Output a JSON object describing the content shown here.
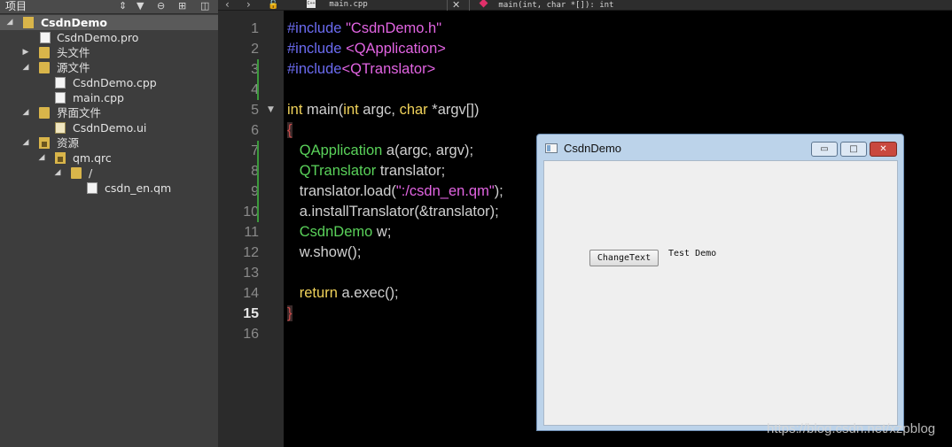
{
  "project_panel": {
    "title": "项目",
    "tree": [
      {
        "label": "CsdnDemo",
        "icon": "project-icon",
        "expanded": true,
        "selected": true
      },
      {
        "label": "CsdnDemo.pro",
        "icon": "pro-file-icon"
      },
      {
        "label": "头文件",
        "icon": "header-folder-icon",
        "expanded": false
      },
      {
        "label": "源文件",
        "icon": "source-folder-icon",
        "expanded": true
      },
      {
        "label": "CsdnDemo.cpp",
        "icon": "cpp-file-icon"
      },
      {
        "label": "main.cpp",
        "icon": "cpp-file-icon"
      },
      {
        "label": "界面文件",
        "icon": "forms-folder-icon",
        "expanded": true
      },
      {
        "label": "CsdnDemo.ui",
        "icon": "ui-file-icon"
      },
      {
        "label": "资源",
        "icon": "resources-folder-icon",
        "expanded": true
      },
      {
        "label": "qm.qrc",
        "icon": "qrc-file-icon",
        "expanded": true
      },
      {
        "label": "/",
        "icon": "folder-icon",
        "expanded": true
      },
      {
        "label": "csdn_en.qm",
        "icon": "file-icon"
      }
    ]
  },
  "editor": {
    "file_tab": "main.cpp",
    "file_tab_badge": "C++",
    "symbol": "main(int, char *[]): int",
    "current_line": 15,
    "lines": [
      [
        {
          "t": "#include ",
          "c": "pre"
        },
        {
          "t": "\"CsdnDemo.h\"",
          "c": "str"
        }
      ],
      [
        {
          "t": "#include ",
          "c": "pre"
        },
        {
          "t": "<QApplication>",
          "c": "str"
        }
      ],
      [
        {
          "t": "#include",
          "c": "pre"
        },
        {
          "t": "<QTranslator>",
          "c": "str"
        }
      ],
      [],
      [
        {
          "t": "int",
          "c": "kw"
        },
        {
          "t": " main(",
          "c": "plain"
        },
        {
          "t": "int",
          "c": "kw"
        },
        {
          "t": " argc, ",
          "c": "plain"
        },
        {
          "t": "char",
          "c": "kw"
        },
        {
          "t": " *argv[])",
          "c": "plain"
        }
      ],
      [
        {
          "t": "{",
          "c": "brace"
        }
      ],
      [
        {
          "t": "   ",
          "c": "plain"
        },
        {
          "t": "QApplication",
          "c": "type"
        },
        {
          "t": " a(argc, argv);",
          "c": "plain"
        }
      ],
      [
        {
          "t": "   ",
          "c": "plain"
        },
        {
          "t": "QTranslator",
          "c": "type"
        },
        {
          "t": " translator;",
          "c": "plain"
        }
      ],
      [
        {
          "t": "   translator.load(",
          "c": "plain"
        },
        {
          "t": "\":/csdn_en.qm\"",
          "c": "str"
        },
        {
          "t": ");",
          "c": "plain"
        }
      ],
      [
        {
          "t": "   a.installTranslator(&translator);",
          "c": "plain"
        }
      ],
      [
        {
          "t": "   ",
          "c": "plain"
        },
        {
          "t": "CsdnDemo",
          "c": "type"
        },
        {
          "t": " w;",
          "c": "plain"
        }
      ],
      [
        {
          "t": "   w.show();",
          "c": "plain"
        }
      ],
      [],
      [
        {
          "t": "   ",
          "c": "plain"
        },
        {
          "t": "return",
          "c": "kw"
        },
        {
          "t": " a.exec();",
          "c": "plain"
        }
      ],
      [
        {
          "t": "}",
          "c": "brace"
        }
      ],
      []
    ]
  },
  "demo_window": {
    "title": "CsdnDemo",
    "button_label": "ChangeText",
    "label_text": "Test Demo",
    "min_glyph": "▭",
    "max_glyph": "□",
    "close_glyph": "✕"
  },
  "watermark": "https://blog.csdn.net/xzpblog",
  "colors": {
    "preprocessor": "#6b6bf0",
    "string": "#e264e2",
    "keyword": "#f0d25a",
    "type": "#5ad25a",
    "modified_marker": "#3c9a3c"
  }
}
